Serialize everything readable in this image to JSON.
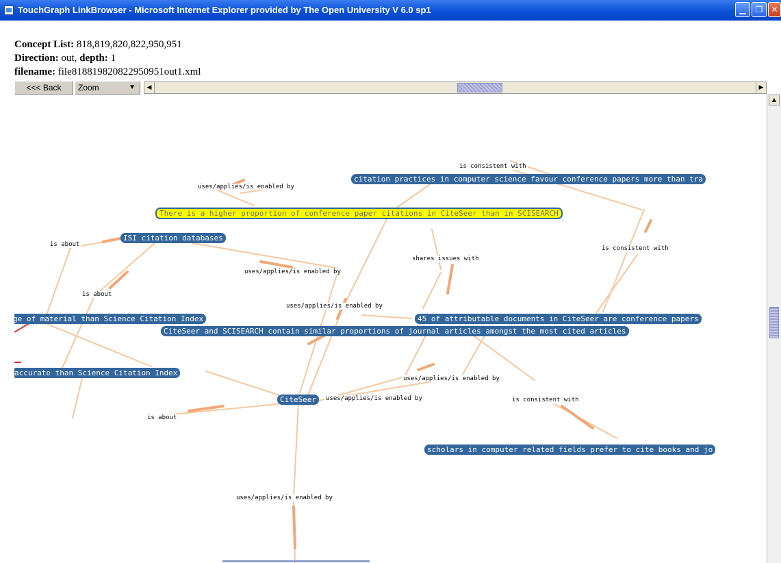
{
  "window": {
    "title": "TouchGraph LinkBrowser - Microsoft Internet Explorer provided by The Open University V 6.0 sp1",
    "min_icon": "minimize-icon",
    "max_icon": "maximize-icon",
    "close_icon": "close-icon"
  },
  "info": {
    "concept_label": "Concept List:",
    "concept_value": " 818,819,820,822,950,951",
    "direction_label": "Direction:",
    "direction_value": " out, ",
    "depth_label": "depth:",
    "depth_value": " 1",
    "filename_label": "filename:",
    "filename_value": " file818819820822950951out1.xml"
  },
  "toolbar": {
    "back_label": "<<< Back",
    "zoom_label": "Zoom",
    "zoom_arrow": "▼"
  },
  "graph": {
    "nodes": {
      "citation_practices": "citation practices in computer science favour conference papers more than tra",
      "higher_proportion": "There is a higher proportion of conference paper citations in CiteSeer than in SCISEARCH",
      "isi": "ISI citation databases",
      "coverage": "ge of material than Science Citation Index",
      "attributable": "45  of attributable documents in CiteSeer are conference papers",
      "journal_articles": "CiteSeer and SCISEARCH contain similar proportions of journal articles amongst the most cited articles",
      "accurate": "accurate than Science Citation Index",
      "citeseer": "CiteSeer",
      "scholars": "scholars in computer related fields prefer to cite books and jo"
    },
    "edge_labels": {
      "consistent_top": "is consistent with",
      "uses_top": "uses/applies/is enabled by",
      "is_about_left": "is about",
      "consistent_right": "is consistent with",
      "shares": "shares issues with",
      "uses_mid": "uses/applies/is enabled by",
      "is_about_mid": "is about",
      "uses_center": "uses/applies/is enabled by",
      "uses_lowright": "uses/applies/is enabled by",
      "uses_citeseer": "uses/applies/is enabled by",
      "consistent_low": "is consistent with",
      "is_about_low": "is about",
      "uses_bottom": "uses/applies/is enabled by"
    }
  },
  "colors": {
    "node_fill": "#33669c",
    "selected_fill": "#ffff00",
    "edge": "#f5c8a0",
    "title_bar": "#0a50d8"
  }
}
